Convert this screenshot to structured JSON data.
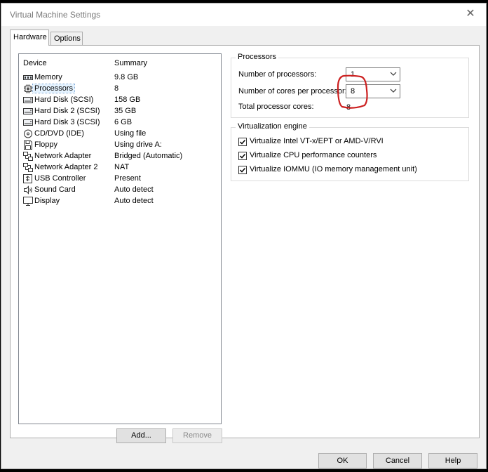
{
  "window": {
    "title": "Virtual Machine Settings",
    "close_glyph": "✕"
  },
  "tabs": [
    {
      "label": "Hardware",
      "active": true
    },
    {
      "label": "Options",
      "active": false
    }
  ],
  "device_list": {
    "headers": {
      "device": "Device",
      "summary": "Summary"
    },
    "items": [
      {
        "name": "Memory",
        "summary": "9.8 GB",
        "icon": "memory-icon"
      },
      {
        "name": "Processors",
        "summary": "8",
        "icon": "processor-icon",
        "selected": true
      },
      {
        "name": "Hard Disk (SCSI)",
        "summary": "158 GB",
        "icon": "hard-disk-icon"
      },
      {
        "name": "Hard Disk 2 (SCSI)",
        "summary": "35 GB",
        "icon": "hard-disk-icon"
      },
      {
        "name": "Hard Disk 3 (SCSI)",
        "summary": "6 GB",
        "icon": "hard-disk-icon"
      },
      {
        "name": "CD/DVD (IDE)",
        "summary": "Using file",
        "icon": "cd-dvd-icon"
      },
      {
        "name": "Floppy",
        "summary": "Using drive A:",
        "icon": "floppy-icon"
      },
      {
        "name": "Network Adapter",
        "summary": "Bridged (Automatic)",
        "icon": "network-adapter-icon"
      },
      {
        "name": "Network Adapter 2",
        "summary": "NAT",
        "icon": "network-adapter-icon"
      },
      {
        "name": "USB Controller",
        "summary": "Present",
        "icon": "usb-icon"
      },
      {
        "name": "Sound Card",
        "summary": "Auto detect",
        "icon": "speaker-icon"
      },
      {
        "name": "Display",
        "summary": "Auto detect",
        "icon": "monitor-icon"
      }
    ],
    "add_button": "Add...",
    "remove_button": "Remove"
  },
  "processors": {
    "legend": "Processors",
    "num_processors_label": "Number of processors:",
    "num_processors_value": "1",
    "cores_label": "Number of cores per processor:",
    "cores_value": "8",
    "total_label": "Total processor cores:",
    "total_value": "8"
  },
  "virtualization": {
    "legend": "Virtualization engine",
    "options": [
      {
        "label": "Virtualize Intel VT-x/EPT or AMD-V/RVI",
        "checked": true
      },
      {
        "label": "Virtualize CPU performance counters",
        "checked": true
      },
      {
        "label": "Virtualize IOMMU (IO memory management unit)",
        "checked": true
      }
    ]
  },
  "footer": {
    "ok": "OK",
    "cancel": "Cancel",
    "help": "Help"
  },
  "colors": {
    "annotation": "#cc1f1f",
    "selection": "#e5f3ff"
  }
}
